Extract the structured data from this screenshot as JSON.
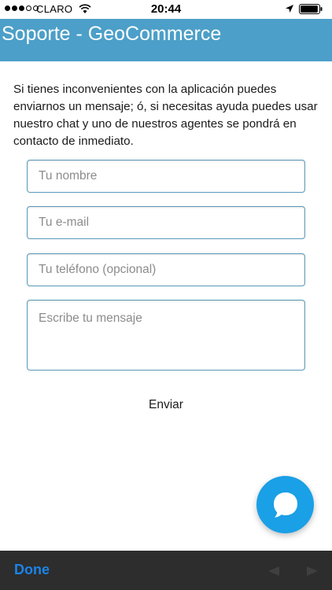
{
  "status_bar": {
    "carrier": "CLARO",
    "time": "20:44",
    "signal_bars_full": 3,
    "signal_bars_total": 5,
    "battery_level": 0.95
  },
  "header": {
    "title": "Soporte - GeoCommerce",
    "background_color": "#4c9fc8"
  },
  "intro": {
    "text": "Si tienes inconvenientes con la aplicación puedes enviarnos un mensaje; ó, si necesitas ayuda puedes usar nuestro chat y uno de nuestros agentes se pondrá en contacto de inmediato."
  },
  "form": {
    "name_placeholder": "Tu nombre",
    "email_placeholder": "Tu e-mail",
    "phone_placeholder": "Tu teléfono (opcional)",
    "message_placeholder": "Escribe tu mensaje",
    "send_label": "Enviar"
  },
  "chat": {
    "icon": "chat-bubble-icon",
    "color": "#1aa0e6"
  },
  "toolbar": {
    "done_label": "Done",
    "done_color": "#1a84e8",
    "back_icon": "back-arrow-icon",
    "forward_icon": "forward-arrow-icon"
  }
}
